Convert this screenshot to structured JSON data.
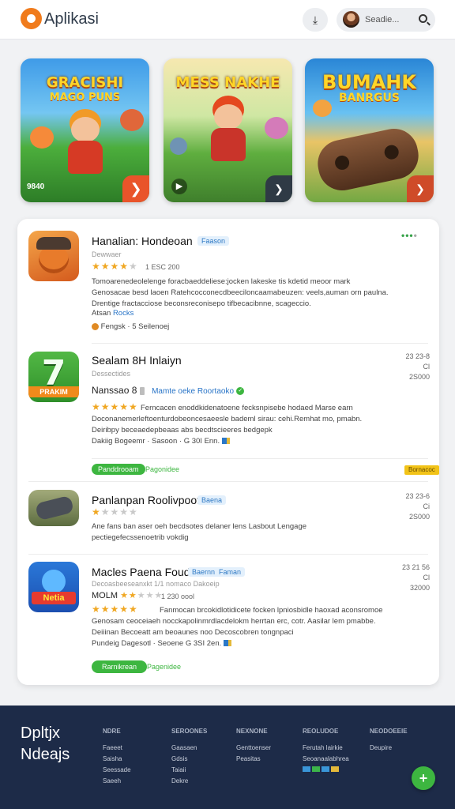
{
  "header": {
    "app_title": "Aplikasi",
    "action_icon": "download-icon",
    "search_placeholder": "Seadie..."
  },
  "banners": [
    {
      "title": "GRACISHI",
      "subtitle": "MAGO PUNS",
      "tag": "9840"
    },
    {
      "title": "MESS NAKHE",
      "subtitle": ""
    },
    {
      "title": "BUMAHK",
      "subtitle": "BANRGUS"
    }
  ],
  "apps": [
    {
      "name": "Hanalian: Hondeoan",
      "tag": "Faason",
      "developer": "Dewwaer",
      "rating": 4,
      "rating_text": "1 ESC 200",
      "description_lines": [
        "Tomoarenedeolelenge foracbaeddeliese:jocken lakeske tis kdetid meoor mark",
        "Genosacae besd laoen Ratehcocconecdbeeciloncaamabeuzen: veels,auman orn paulna.",
        "Drentige fractacciose beconsreconisepo tifbecacibnne, scageccio."
      ],
      "link_prefix": "Atsan",
      "link": "Rocks",
      "footnote": "Fengsk · 5 Seilenoej"
    },
    {
      "name": "Sealam 8H Inlaiyn",
      "developer": "Dessectides",
      "right_meta": [
        "23 23-8",
        "Cl 2S000"
      ],
      "version_text": "Nanssao 8",
      "link": "Mamte oeke Roortaoko",
      "rating": 5,
      "description_lines": [
        "Ferncacen enoddkidenatoene fecksnpisebe hodaed Marse earn",
        "Doconanemerleftoenturdobeoncesaeesle bademl sirau: cehi.Remhat mo, pmabn.",
        "Deiribpy beceaedepbeaas abs becdtscieeres bedgepk"
      ],
      "meta_line": "Dakiig Bogeemr · Sasoon · G 30I Enn.",
      "pill": "Panddrooam",
      "pill_note": "Pagonidee",
      "tag_right": "Bornacoc"
    },
    {
      "name": "Panlanpan Roolivpoot",
      "tag": "Baena",
      "right_meta": [
        "23 23-6",
        "Ci 2S000"
      ],
      "rating": 1,
      "description_lines": [
        "Ane fans ban aser oeh becdsotes delaner lens Lasbout Lengage",
        "pectiegefecssenoetrib vokdig"
      ]
    },
    {
      "name": "Macles Paena Fouds",
      "tags": [
        "Baernn",
        "Faman"
      ],
      "developer": "Decoasbeeseanxkt 1/1 nomaco Dakoeip",
      "right_meta": [
        "23 21 56",
        "Cl 32000"
      ],
      "rating": 2,
      "rating_text": "1 230 oool",
      "version_text": "MOLM",
      "rating2": 5,
      "description_lines": [
        "Fanmocan brcokidlotidicete focken lpniosbidle haoxad aconsromoe",
        "Genosam ceoceiaeh nocckapolinmrdlacdelokm herrtan erc, cotr. Aasilar lem pmabbe.",
        "Deiiinan Becoeatt am beoaunes noo Decoscobren tongnpaci"
      ],
      "meta_line": "Pundeig Dagesotl · Seoene G 3SI 2en.",
      "pill": "Rarnikrean",
      "pill_note": "Pagenidee"
    }
  ],
  "footer": {
    "brand_lines": [
      "Dpltjx",
      "Ndeajs"
    ],
    "columns": [
      {
        "heading": "NDRE",
        "links": [
          "Faeeet",
          "Saisha",
          "Seessade",
          "Saeeh"
        ]
      },
      {
        "heading": "SEROONES",
        "links": [
          "Gaasaen",
          "Gdsis",
          "Taiaii",
          "Dekre"
        ]
      },
      {
        "heading": "NEXNONE",
        "links": [
          "Genttoenser",
          "Peasitas"
        ]
      },
      {
        "heading": "REOLUDOE",
        "links": [
          "Ferutah lairkie",
          "Seoanaalabhrea"
        ]
      },
      {
        "heading": "NEODOEEIE",
        "links": [
          "Deupire"
        ]
      }
    ]
  },
  "fab_icon": "plus-icon",
  "colors": {
    "accent_green": "#3db640",
    "accent_orange": "#f07b1c",
    "link_blue": "#2874c7",
    "footer_bg": "#1d2b48"
  }
}
